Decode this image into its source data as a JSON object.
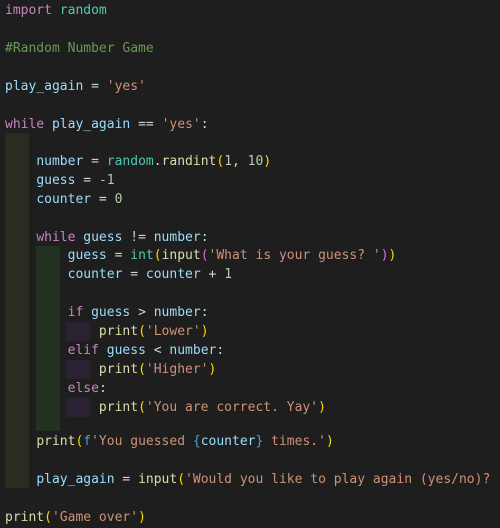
{
  "code": {
    "l1_kw": "import",
    "l1_mod": "random",
    "l3_comment": "#Random Number Game",
    "l5_var": "play_again",
    "l5_op": " = ",
    "l5_str": "'yes'",
    "l7_kw": "while",
    "l7_var": "play_again",
    "l7_op": " == ",
    "l7_str": "'yes'",
    "l7_colon": ":",
    "l9_var": "number",
    "l9_op": " = ",
    "l9_mod": "random",
    "l9_dot": ".",
    "l9_fn": "randint",
    "l9_open": "(",
    "l9_n1": "1",
    "l9_comma": ", ",
    "l9_n2": "10",
    "l9_close": ")",
    "l10_var": "guess",
    "l10_op": " = ",
    "l10_num": "-1",
    "l11_var": "counter",
    "l11_op": " = ",
    "l11_num": "0",
    "l13_kw": "while",
    "l13_var1": "guess",
    "l13_op": " != ",
    "l13_var2": "number",
    "l13_colon": ":",
    "l14_var": "guess",
    "l14_op": " = ",
    "l14_fn1": "int",
    "l14_open1": "(",
    "l14_fn2": "input",
    "l14_open2": "(",
    "l14_str": "'What is your guess? '",
    "l14_close2": ")",
    "l14_close1": ")",
    "l15_var1": "counter",
    "l15_op1": " = ",
    "l15_var2": "counter",
    "l15_op2": " + ",
    "l15_num": "1",
    "l17_kw": "if",
    "l17_var1": "guess",
    "l17_op": " > ",
    "l17_var2": "number",
    "l17_colon": ":",
    "l18_fn": "print",
    "l18_open": "(",
    "l18_str": "'Lower'",
    "l18_close": ")",
    "l19_kw": "elif",
    "l19_var1": "guess",
    "l19_op": " < ",
    "l19_var2": "number",
    "l19_colon": ":",
    "l20_fn": "print",
    "l20_open": "(",
    "l20_str": "'Higher'",
    "l20_close": ")",
    "l21_kw": "else",
    "l21_colon": ":",
    "l22_fn": "print",
    "l22_open": "(",
    "l22_str": "'You are correct. Yay'",
    "l22_close": ")",
    "l24_fn": "print",
    "l24_open": "(",
    "l24_fpre": "f",
    "l24_str1": "'You guessed ",
    "l24_brace1": "{",
    "l24_var": "counter",
    "l24_brace2": "}",
    "l24_str2": " times.'",
    "l24_close": ")",
    "l26_var": "play_again",
    "l26_op": " = ",
    "l26_fn": "input",
    "l26_open": "(",
    "l26_str": "'Would you like to play again (yes/no)? '",
    "l26_close": ")",
    "l28_fn": "print",
    "l28_open": "(",
    "l28_str": "'Game over'",
    "l28_close": ")"
  }
}
